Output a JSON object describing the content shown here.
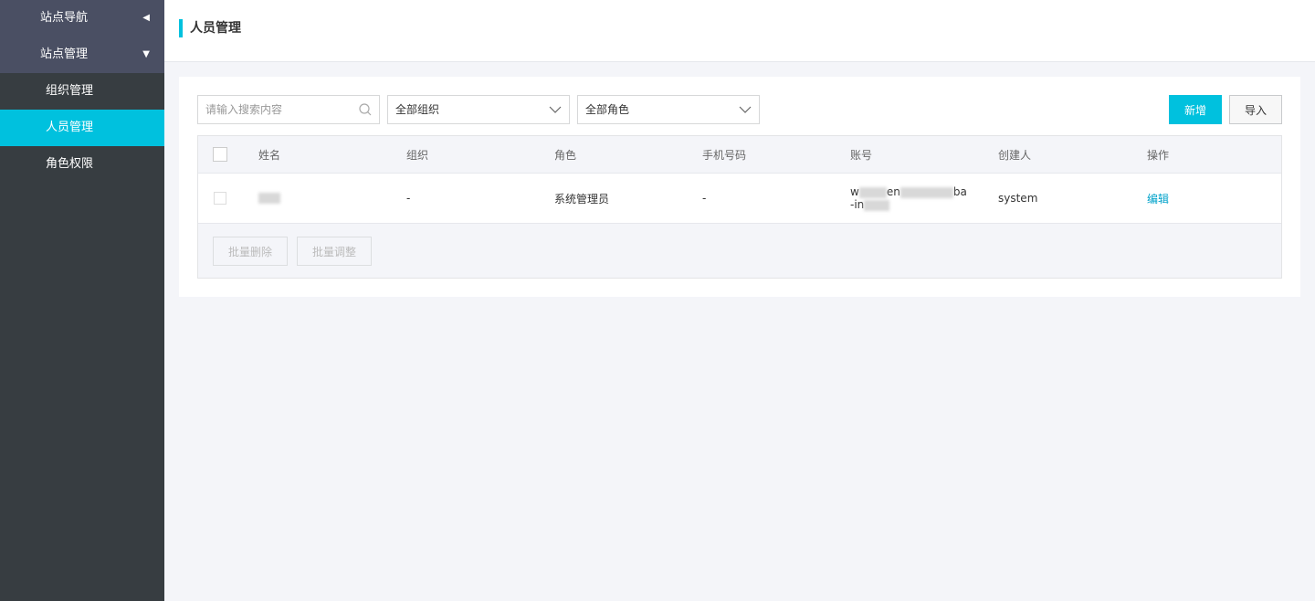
{
  "sidebar": {
    "groups": [
      {
        "label": "站点导航",
        "arrow": "◀"
      },
      {
        "label": "站点管理",
        "arrow": "▼"
      }
    ],
    "items": [
      {
        "label": "组织管理"
      },
      {
        "label": "人员管理"
      },
      {
        "label": "角色权限"
      }
    ]
  },
  "header": {
    "title": "人员管理"
  },
  "toolbar": {
    "search_placeholder": "请输入搜索内容",
    "org_select": "全部组织",
    "role_select": "全部角色",
    "add_label": "新增",
    "import_label": "导入"
  },
  "table": {
    "columns": [
      "姓名",
      "组织",
      "角色",
      "手机号码",
      "账号",
      "创建人",
      "操作"
    ],
    "rows": [
      {
        "name": "",
        "org": "-",
        "role": "系统管理员",
        "phone": "-",
        "account_line1": "w",
        "account_mid": "en",
        "account_end": "ba",
        "account_line2": "-in",
        "creator": "system",
        "action": "编辑"
      }
    ],
    "footer": {
      "batch_delete": "批量删除",
      "batch_adjust": "批量调整"
    }
  },
  "colors": {
    "accent": "#00c1de",
    "sidebar_bg": "#373d41",
    "link": "#00a2ca"
  }
}
